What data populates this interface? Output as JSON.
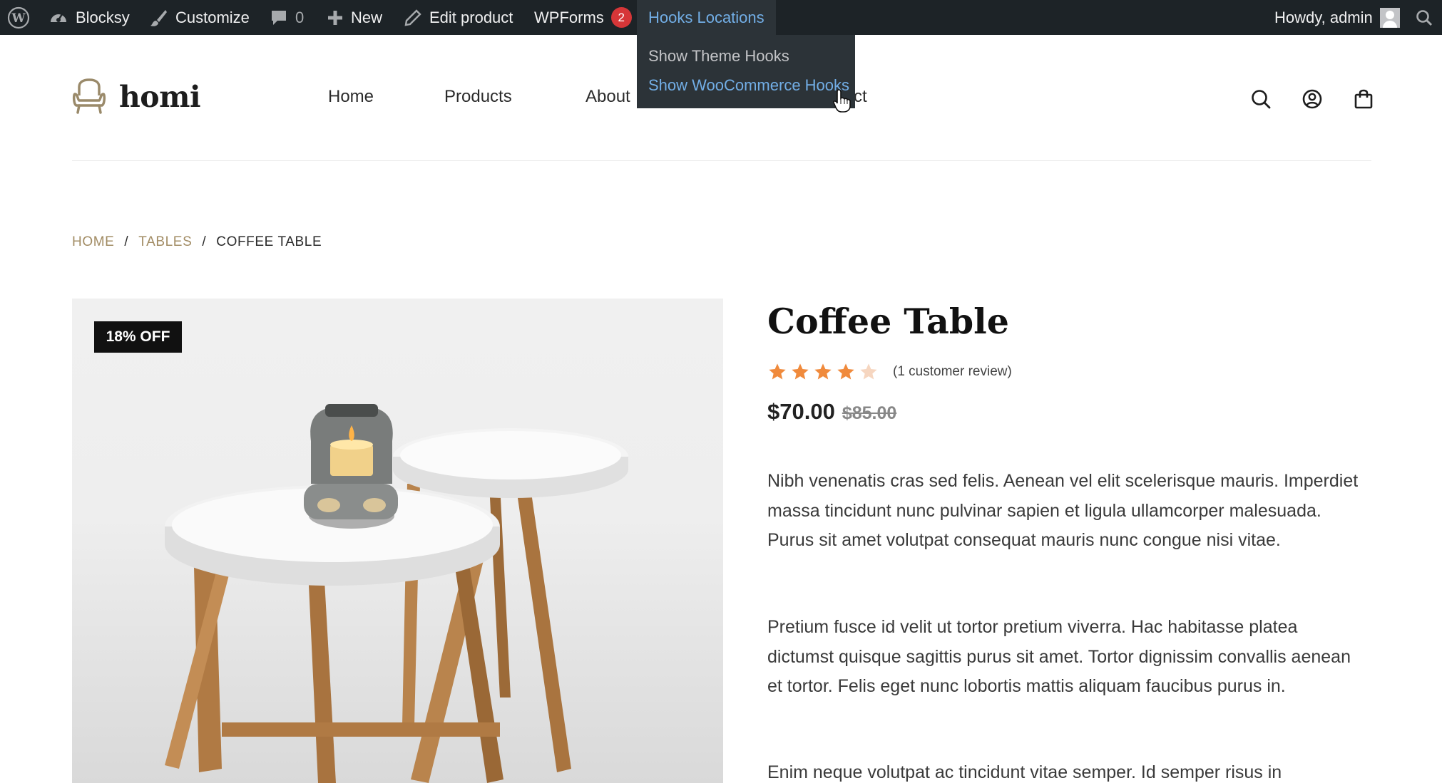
{
  "admin_bar": {
    "site_name": "Blocksy",
    "customize": "Customize",
    "comments_count": "0",
    "new": "New",
    "edit_product": "Edit product",
    "wpforms": "WPForms",
    "wpforms_badge": "2",
    "hooks_locations": "Hooks Locations",
    "howdy": "Howdy, admin",
    "icons": [
      "wordpress-icon",
      "dashboard-icon",
      "brush-icon",
      "comment-icon",
      "plus-icon",
      "pencil-icon",
      "user-avatar",
      "search-icon"
    ]
  },
  "hooks_menu": {
    "items": [
      "Show Theme Hooks",
      "Show WooCommerce Hooks"
    ],
    "hovered_index": 1
  },
  "header": {
    "logo": "homi",
    "nav": [
      "Home",
      "Products",
      "About",
      "ct"
    ],
    "icons": [
      "search-icon",
      "account-icon",
      "cart-icon"
    ]
  },
  "breadcrumb": {
    "items": [
      "HOME",
      "TABLES"
    ],
    "separator": "/",
    "current": "COFFEE TABLE"
  },
  "product": {
    "badge": "18% OFF",
    "title": "Coffee Table",
    "rating": 4,
    "rating_max": 5,
    "review_text": "(1 customer review)",
    "price": "$70.00",
    "regular_price": "$85.00",
    "description": [
      "Nibh venenatis cras sed felis. Aenean vel elit scelerisque mauris. Imperdiet massa tincidunt nunc pulvinar sapien et ligula ullamcorper malesuada. Purus sit amet volutpat consequat mauris nunc congue nisi vitae.",
      "Pretium fusce id velit ut tortor pretium viverra. Hac habitasse platea dictumst quisque sagittis purus sit amet. Tortor dignissim convallis aenean et tortor. Felis eget nunc lobortis mattis aliquam faucibus purus in.",
      "Enim neque volutpat ac tincidunt vitae semper. Id semper risus in"
    ]
  },
  "colors": {
    "admin_bar": "#1d2327",
    "admin_link": "#72aee6",
    "breadcrumb_link": "#a28c64",
    "star": "#f08a3c",
    "sale_badge": "#111111"
  }
}
